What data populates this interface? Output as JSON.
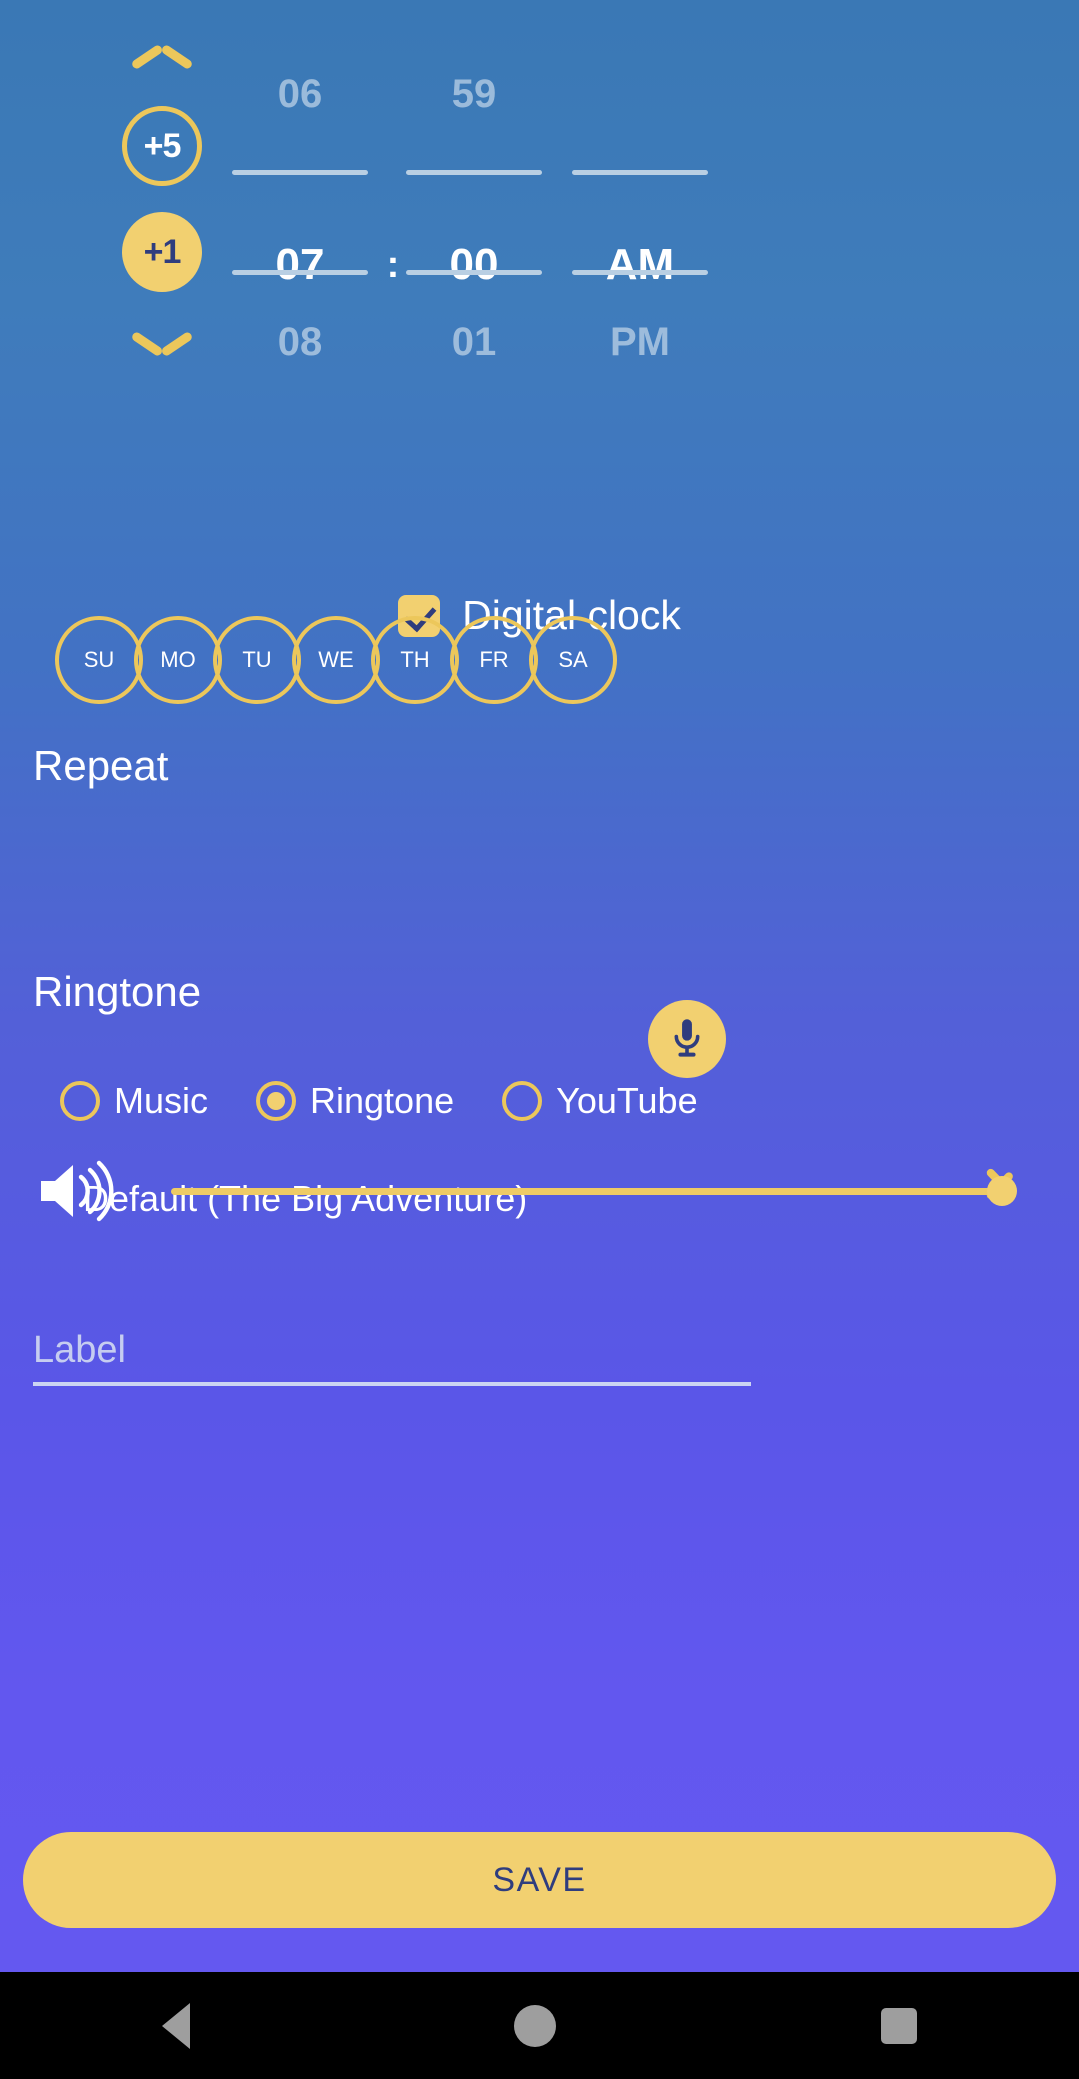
{
  "theme": {
    "accent_yellow": "#f2d070",
    "accent_yellow_outline": "#ecc75b",
    "bg_top": "#3a78b5",
    "bg_bottom": "#6458f0",
    "text_on_accent": "#2f3d7e",
    "rule_color": "#b9cfe3",
    "nav_icon_color": "#9e9e9e"
  },
  "time_picker": {
    "stepper": {
      "up_icon": "chevron-up-icon",
      "down_icon": "chevron-down-icon",
      "plus5_label": "+5",
      "plus1_label": "+1"
    },
    "hour": {
      "prev": "06",
      "current": "07",
      "next": "08"
    },
    "minute": {
      "prev": "59",
      "current": "00",
      "next": "01"
    },
    "meridiem": {
      "prev": "",
      "current": "AM",
      "next": "PM"
    },
    "separator": ":"
  },
  "digital_clock": {
    "label": "Digital clock",
    "checked": true,
    "check_icon": "check-icon"
  },
  "repeat": {
    "title": "Repeat",
    "days": [
      {
        "label": "SU",
        "selected": false
      },
      {
        "label": "MO",
        "selected": false
      },
      {
        "label": "TU",
        "selected": false
      },
      {
        "label": "WE",
        "selected": false
      },
      {
        "label": "TH",
        "selected": false
      },
      {
        "label": "FR",
        "selected": false
      },
      {
        "label": "SA",
        "selected": false
      }
    ]
  },
  "ringtone": {
    "title": "Ringtone",
    "options": [
      {
        "label": "Music",
        "selected": false
      },
      {
        "label": "Ringtone",
        "selected": true
      },
      {
        "label": "YouTube",
        "selected": false
      }
    ],
    "selected_value": "Default (The Big Adventure)",
    "chevron_icon": "chevron-right-icon"
  },
  "label_field": {
    "placeholder": "Label",
    "value": "",
    "mic_icon": "microphone-icon"
  },
  "volume": {
    "icon": "volume-up-icon",
    "value": 100,
    "min": 0,
    "max": 100
  },
  "save": {
    "label": "SAVE"
  },
  "navbar": {
    "back_icon": "back-triangle-icon",
    "home_icon": "home-circle-icon",
    "recents_icon": "recents-square-icon"
  }
}
